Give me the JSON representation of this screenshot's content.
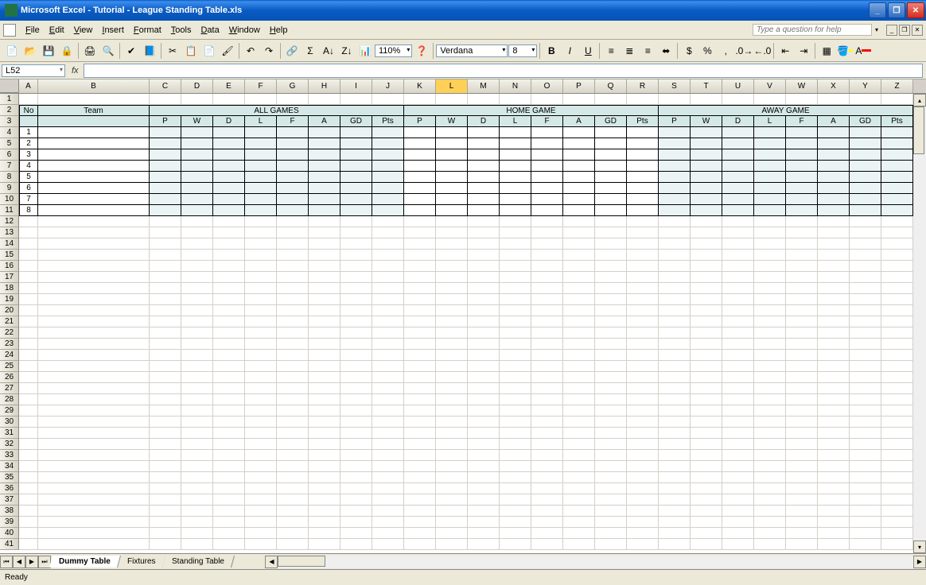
{
  "titlebar": {
    "title": "Microsoft Excel - Tutorial - League Standing Table.xls"
  },
  "menubar": {
    "items": [
      {
        "u": "F",
        "rest": "ile"
      },
      {
        "u": "E",
        "rest": "dit"
      },
      {
        "u": "V",
        "rest": "iew"
      },
      {
        "u": "I",
        "rest": "nsert"
      },
      {
        "u": "",
        "rest": "F",
        "u2": "o",
        "rest2": "rmat"
      },
      {
        "u": "T",
        "rest": "ools"
      },
      {
        "u": "D",
        "rest": "ata"
      },
      {
        "u": "W",
        "rest": "indow"
      },
      {
        "u": "H",
        "rest": "elp"
      }
    ],
    "items_flat": [
      "File",
      "Edit",
      "View",
      "Insert",
      "Format",
      "Tools",
      "Data",
      "Window",
      "Help"
    ],
    "help_placeholder": "Type a question for help"
  },
  "toolbar": {
    "zoom": "110%",
    "font": "Verdana",
    "size": "8"
  },
  "formulabar": {
    "name_box": "L52",
    "fx_label": "fx"
  },
  "grid": {
    "col_letters": [
      "A",
      "B",
      "C",
      "D",
      "E",
      "F",
      "G",
      "H",
      "I",
      "J",
      "K",
      "L",
      "M",
      "N",
      "O",
      "P",
      "Q",
      "R",
      "S",
      "T",
      "U",
      "V",
      "W",
      "X",
      "Y",
      "Z"
    ],
    "col_widths": {
      "A": 24,
      "B": 140,
      "default": 40
    },
    "selected_col": "L",
    "row_count": 41,
    "header_no": "No",
    "header_team": "Team",
    "sections": [
      "ALL GAMES",
      "HOME GAME",
      "AWAY GAME"
    ],
    "sub_headers": [
      "P",
      "W",
      "D",
      "L",
      "F",
      "A",
      "GD",
      "Pts"
    ],
    "data_row_nums": [
      "1",
      "2",
      "3",
      "4",
      "5",
      "6",
      "7",
      "8"
    ]
  },
  "tabs": {
    "items": [
      "Dummy Table",
      "Fixtures",
      "Standing Table"
    ],
    "active": 0
  },
  "statusbar": {
    "text": "Ready"
  }
}
